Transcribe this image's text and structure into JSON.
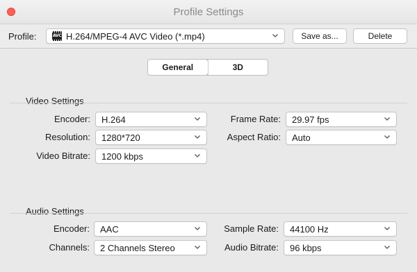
{
  "window": {
    "title": "Profile Settings"
  },
  "toolbar": {
    "profile_label": "Profile:",
    "profile_value": "H.264/MPEG-4 AVC Video (*.mp4)",
    "profile_icon": "avc-icon",
    "save_as_label": "Save as...",
    "delete_label": "Delete"
  },
  "tabs": [
    {
      "label": "General",
      "active": true
    },
    {
      "label": "3D",
      "active": false
    }
  ],
  "video": {
    "title": "Video Settings",
    "encoder_label": "Encoder:",
    "encoder_value": "H.264",
    "resolution_label": "Resolution:",
    "resolution_value": "1280*720",
    "bitrate_label": "Video Bitrate:",
    "bitrate_value": "1200 kbps",
    "framerate_label": "Frame Rate:",
    "framerate_value": "29.97 fps",
    "aspect_label": "Aspect Ratio:",
    "aspect_value": "Auto"
  },
  "audio": {
    "title": "Audio Settings",
    "encoder_label": "Encoder:",
    "encoder_value": "AAC",
    "channels_label": "Channels:",
    "channels_value": "2 Channels Stereo",
    "samplerate_label": "Sample Rate:",
    "samplerate_value": "44100 Hz",
    "bitrate_label": "Audio Bitrate:",
    "bitrate_value": "96 kbps"
  },
  "colors": {
    "close": "#ff5f57",
    "tab_accent": "#e3a24c"
  }
}
